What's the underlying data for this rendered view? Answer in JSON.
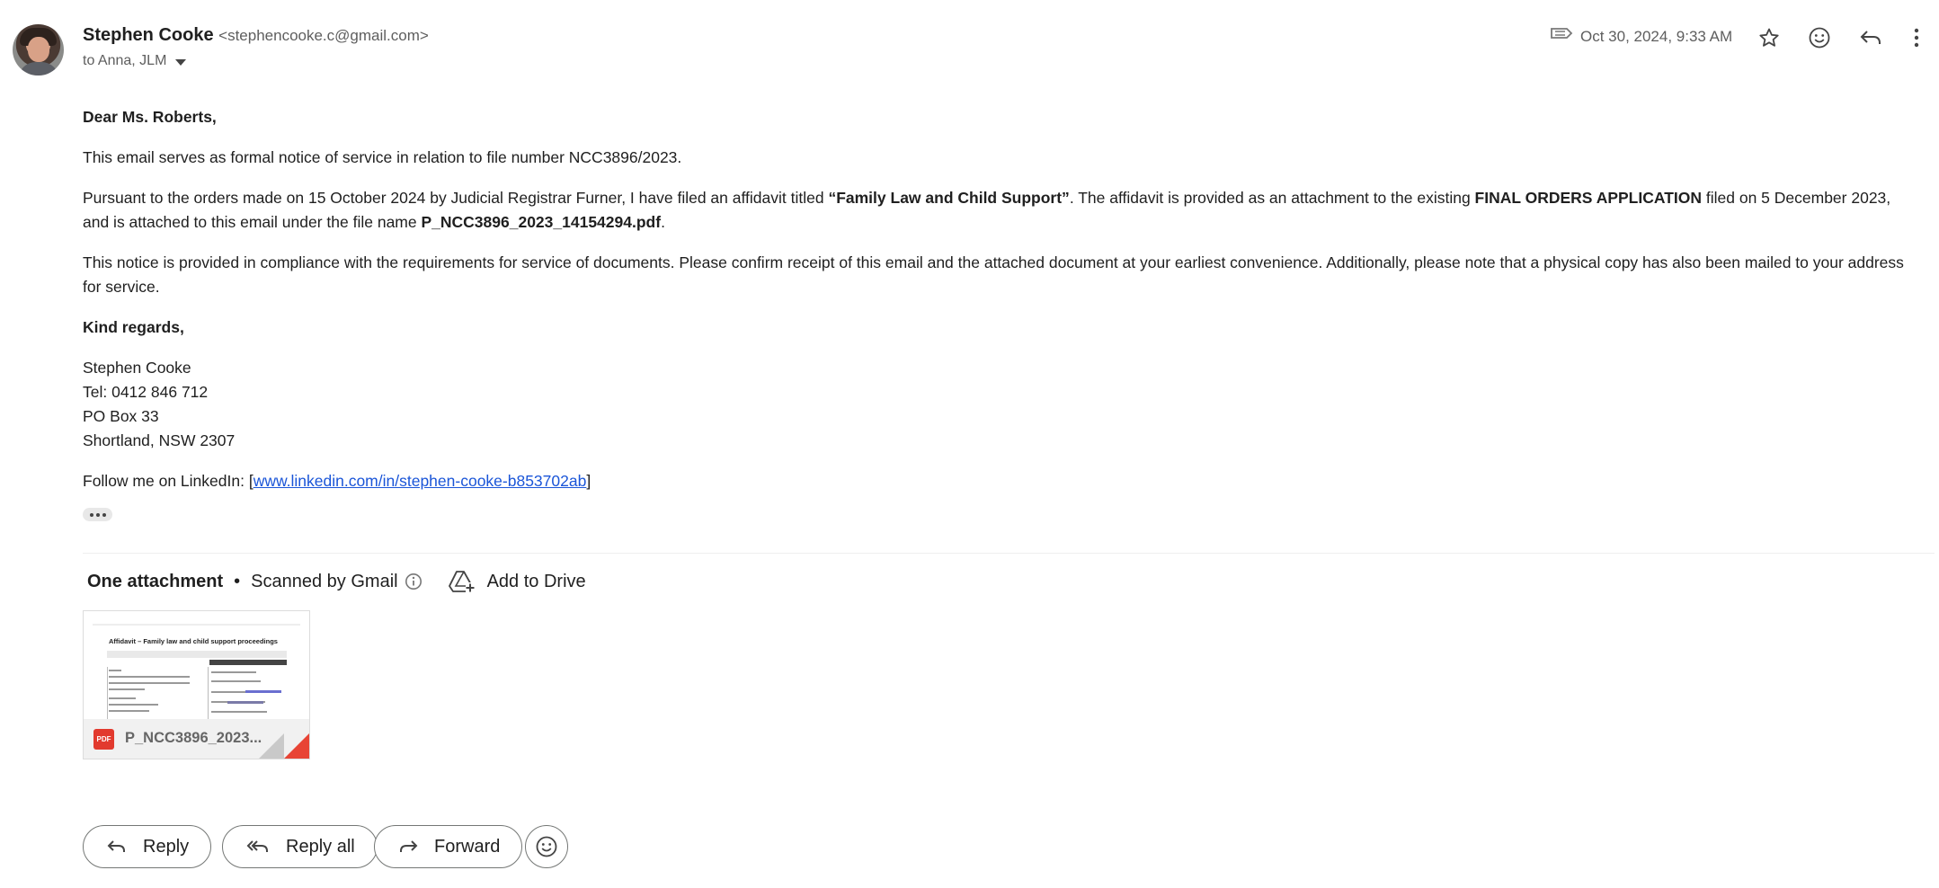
{
  "sender": {
    "name": "Stephen Cooke",
    "email": "<stephencooke.c@gmail.com>",
    "recipients": "to Anna, JLM"
  },
  "header": {
    "timestamp": "Oct 30, 2024, 9:33 AM",
    "icons": [
      "label-icon",
      "star-icon",
      "emoji-icon",
      "reply-icon",
      "more-vert-icon"
    ]
  },
  "body": {
    "greeting": "Dear Ms. Roberts,",
    "p1": "This email serves as formal notice of service in relation to file number NCC3896/2023.",
    "p2_a": "Pursuant to the orders made on 15 October 2024 by Judicial Registrar Furner, I have filed an affidavit titled ",
    "p2_title": "“Family Law and Child Support”",
    "p2_b": ". The affidavit is provided as an attachment to the existing ",
    "p2_app": "FINAL ORDERS APPLICATION",
    "p2_c": " filed on 5 December 2023, and is attached to this email under the file name ",
    "p2_file": "P_NCC3896_2023_14154294.pdf",
    "p2_d": ".",
    "p3": "This notice is provided in compliance with the requirements for service of documents. Please confirm receipt of this email and the attached document at your earliest convenience. Additionally, please note that a physical copy has also been mailed to your address for service.",
    "closing": "Kind regards,",
    "sig_name": "Stephen Cooke",
    "sig_tel": "Tel: 0412 846 712",
    "sig_po": "PO Box 33",
    "sig_city": "Shortland, NSW 2307",
    "follow_prefix": "Follow me on LinkedIn: [",
    "follow_link": "www.linkedin.com/in/stephen-cooke-b853702ab",
    "follow_suffix": "]"
  },
  "attachments": {
    "title": "One attachment",
    "bullet": "•",
    "scanned": "Scanned by Gmail",
    "add_drive": "Add to Drive",
    "file": {
      "thumb_title": "Affidavit – Family law and child support proceedings",
      "badge": "PDF",
      "name": "P_NCC3896_2023..."
    }
  },
  "actions": {
    "reply": "Reply",
    "reply_all": "Reply all",
    "forward": "Forward"
  },
  "colors": {
    "link": "#1a55d8",
    "pdf_red": "#e23a2e",
    "text": "#1f1f1f",
    "muted": "#5e5e5e"
  }
}
